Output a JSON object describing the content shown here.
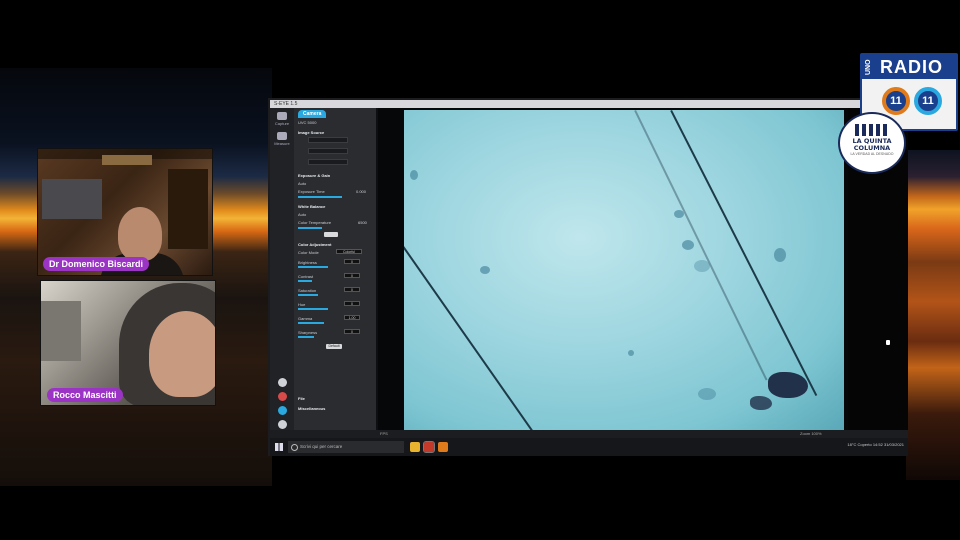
{
  "participants": [
    {
      "name": "Dr Domenico Biscardi"
    },
    {
      "name": "Rocco Mascitti"
    }
  ],
  "logos": {
    "radio": {
      "text": "RADIO",
      "prefix": "UNO",
      "left_number": "11",
      "right_number": "11"
    },
    "quinta": {
      "line1": "LA QUINTA",
      "line2": "COLUMNA",
      "sub": "LA VERDAD AL DESNUDO"
    }
  },
  "app": {
    "title": "S-EYE 1.5",
    "toolbar": {
      "capture_label": "Capture",
      "measure_label": "Measure"
    },
    "panel": {
      "tab_label": "Camera",
      "device_label": "UVC 5000",
      "sections": {
        "image_source": "Image Source",
        "exposure_gain": "Exposure & Gain",
        "white_balance": "White Balance",
        "color_adjustment": "Color Adjustment",
        "file": "File",
        "miscellaneous": "Miscellaneous"
      },
      "auto_label": "Auto",
      "exposure_time_label": "Exposure Time",
      "exposure_time_value": "0.000",
      "color_temperature_label": "Color Temperature",
      "color_temperature_value": "6500",
      "color_mode_label": "Color Mode",
      "color_mode_value": "Colorful",
      "adjustments": [
        {
          "label": "Brightness",
          "value": "0"
        },
        {
          "label": "Contrast",
          "value": "0"
        },
        {
          "label": "Saturation",
          "value": "0"
        },
        {
          "label": "Hue",
          "value": "0"
        },
        {
          "label": "Gamma",
          "value": "1.00"
        },
        {
          "label": "Sharpness",
          "value": "0"
        }
      ],
      "default_button": "Default"
    },
    "status_bar": {
      "fps": "FPS",
      "zoom": "Zoom 100%"
    }
  },
  "taskbar": {
    "search_placeholder": "Scrivi qui per cercare",
    "tray_weather": "18°C",
    "tray_text": "Coperto",
    "tray_time": "14:52",
    "tray_date": "31/03/2021"
  }
}
